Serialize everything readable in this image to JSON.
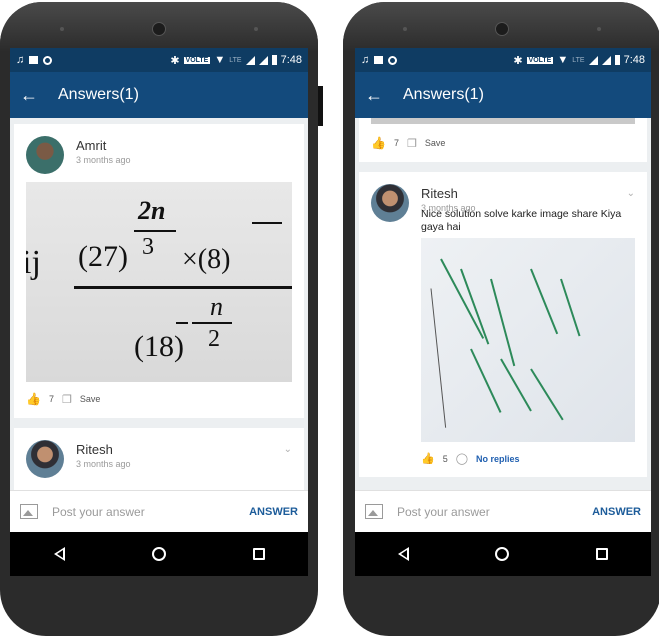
{
  "status_bar": {
    "time": "7:48",
    "volte": "VOLTE",
    "lte": "LTE"
  },
  "app_bar": {
    "title": "Answers(1)"
  },
  "left_screen": {
    "answer1": {
      "author": "Amrit",
      "time": "3 months ago",
      "likes": "7",
      "save_label": "Save"
    },
    "answer2": {
      "author": "Ritesh",
      "time": "3 months ago"
    }
  },
  "right_screen": {
    "prev_actions": {
      "likes": "7",
      "save_label": "Save"
    },
    "answer": {
      "author": "Ritesh",
      "time": "3 months ago",
      "text": "Nice solution solve karke image share Kiya gaya hai",
      "likes": "5",
      "replies_label": "No replies"
    }
  },
  "compose": {
    "placeholder": "Post your answer",
    "button": "ANSWER"
  },
  "colors": {
    "status_bar": "#0f3c63",
    "app_bar": "#134a7c",
    "accent": "#1d5c9a",
    "like": "#2b6cc4"
  },
  "icons": [
    "music-icon",
    "image-icon",
    "circle-icon",
    "bluetooth-icon",
    "wifi-icon",
    "signal-icon",
    "battery-icon",
    "back-arrow-icon",
    "chevron-down-icon",
    "thumbs-up-icon",
    "bookmark-icon",
    "comment-icon",
    "nav-back-icon",
    "nav-home-icon",
    "nav-recents-icon"
  ]
}
